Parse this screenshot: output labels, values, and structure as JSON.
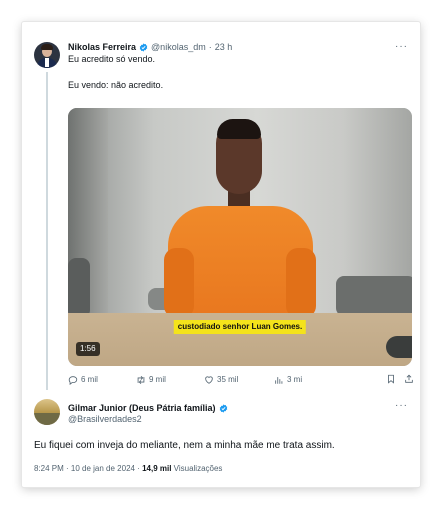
{
  "tweet": {
    "author_name": "Nikolas Ferreira",
    "author_handle": "@nikolas_dm",
    "separator": "·",
    "time": "23 h",
    "text_line1": "Eu acredito só vendo.",
    "text_line2": "Eu vendo: não acredito.",
    "more_label": "···",
    "video": {
      "caption": "custodiado senhor Luan Gomes.",
      "duration": "1:56"
    },
    "actions": {
      "replies": "6 mil",
      "retweets": "9 mil",
      "likes": "35 mil",
      "views": "3 mi"
    }
  },
  "reply": {
    "author_name": "Gilmar Junior (Deus Pátria família)",
    "author_handle": "@Brasilverdades2",
    "more_label": "···",
    "text": "Eu fiquei com inveja do meliante, nem a minha mãe me trata assim.",
    "meta_time": "8:24 PM · 10 de jan de 2024 · ",
    "meta_views_count": "14,9 mil",
    "meta_views_label": " Visualizações"
  },
  "colors": {
    "verified": "#1d9bf0",
    "text_primary": "#0f1419",
    "text_secondary": "#536471",
    "caption_bg": "#f4e31b"
  }
}
